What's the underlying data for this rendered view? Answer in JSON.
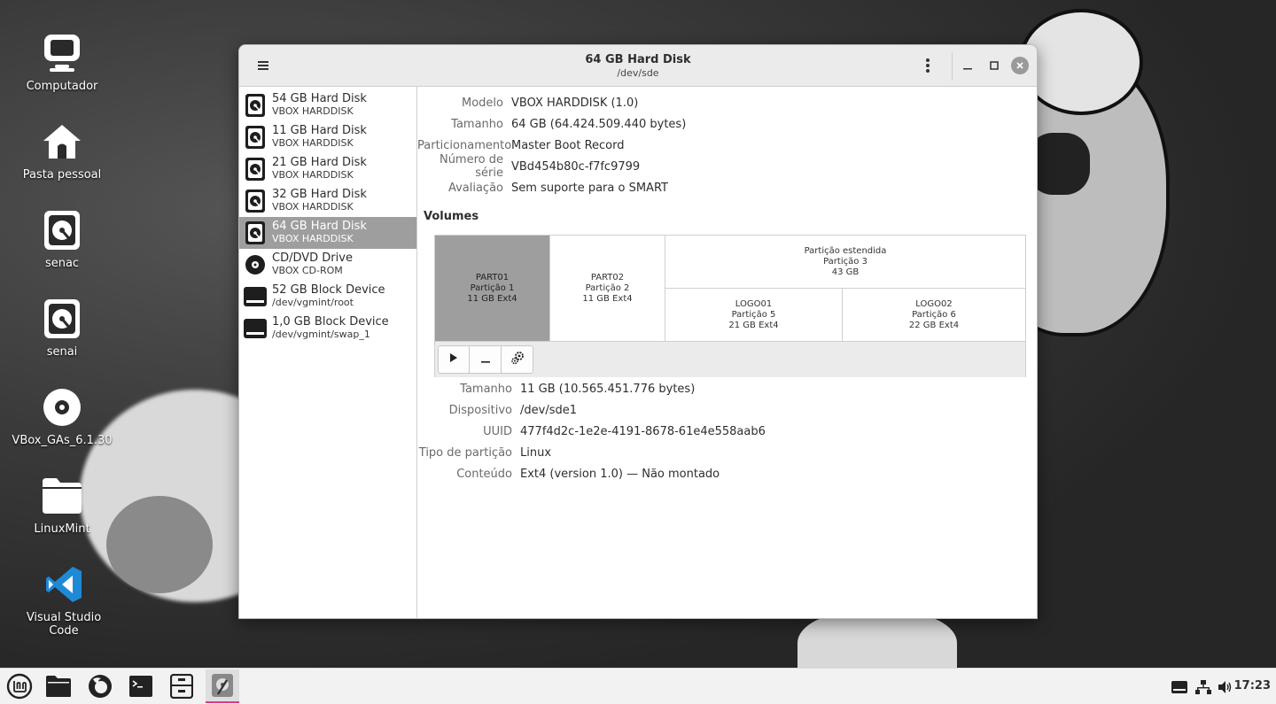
{
  "desktop": {
    "icons": [
      {
        "label": "Computador",
        "icon": "monitor-icon"
      },
      {
        "label": "Pasta pessoal",
        "icon": "home-icon"
      },
      {
        "label": "senac",
        "icon": "harddisk-icon"
      },
      {
        "label": "senai",
        "icon": "harddisk-icon"
      },
      {
        "label": "VBox_GAs_6.1.30",
        "icon": "disc-icon"
      },
      {
        "label": "LinuxMint",
        "icon": "folder-icon"
      },
      {
        "label": "Visual Studio Code",
        "icon": "vscode-icon"
      }
    ]
  },
  "window": {
    "title": "64 GB Hard Disk",
    "subtitle": "/dev/sde",
    "buttons": {
      "menu": "hamburger-menu-icon",
      "more": "vertical-dots-icon",
      "minimize": "minimize-icon",
      "maximize": "maximize-icon",
      "close": "close-icon"
    }
  },
  "sidebar": {
    "items": [
      {
        "name": "54 GB Hard Disk",
        "sub": "VBOX HARDDISK",
        "icon": "harddisk-icon",
        "selected": false
      },
      {
        "name": "11 GB Hard Disk",
        "sub": "VBOX HARDDISK",
        "icon": "harddisk-icon",
        "selected": false
      },
      {
        "name": "21 GB Hard Disk",
        "sub": "VBOX HARDDISK",
        "icon": "harddisk-icon",
        "selected": false
      },
      {
        "name": "32 GB Hard Disk",
        "sub": "VBOX HARDDISK",
        "icon": "harddisk-icon",
        "selected": false
      },
      {
        "name": "64 GB Hard Disk",
        "sub": "VBOX HARDDISK",
        "icon": "harddisk-icon",
        "selected": true
      },
      {
        "name": "CD/DVD Drive",
        "sub": "VBOX CD-ROM",
        "icon": "optical-drive-icon",
        "selected": false
      },
      {
        "name": "52 GB Block Device",
        "sub": "/dev/vgmint/root",
        "icon": "block-device-icon",
        "selected": false
      },
      {
        "name": "1,0 GB Block Device",
        "sub": "/dev/vgmint/swap_1",
        "icon": "block-device-icon",
        "selected": false
      }
    ]
  },
  "disk_info": {
    "model_label": "Modelo",
    "model": "VBOX HARDDISK (1.0)",
    "size_label": "Tamanho",
    "size": "64 GB (64.424.509.440 bytes)",
    "partitioning_label": "Particionamento",
    "partitioning": "Master Boot Record",
    "serial_label": "Número de série",
    "serial": "VBd454b80c-f7fc9799",
    "assessment_label": "Avaliação",
    "assessment": "Sem suporte para o SMART"
  },
  "volumes": {
    "heading": "Volumes",
    "partitions": {
      "part1": {
        "name": "PART01",
        "type": "Partição 1",
        "size": "11 GB Ext4"
      },
      "part2": {
        "name": "PART02",
        "type": "Partição 2",
        "size": "11 GB Ext4"
      },
      "extended": {
        "name": "Partição estendida",
        "type": "Partição 3",
        "size": "43 GB"
      },
      "logo1": {
        "name": "LOGO01",
        "type": "Partição 5",
        "size": "21 GB Ext4"
      },
      "logo2": {
        "name": "LOGO02",
        "type": "Partição 6",
        "size": "22 GB Ext4"
      }
    },
    "toolbar": {
      "mount": "play-icon",
      "delete": "minus-icon",
      "settings": "gears-icon"
    }
  },
  "volume_info": {
    "size_label": "Tamanho",
    "size": "11 GB (10.565.451.776 bytes)",
    "device_label": "Dispositivo",
    "device": "/dev/sde1",
    "uuid_label": "UUID",
    "uuid": "477f4d2c-1e2e-4191-8678-61e4e558aab6",
    "ptype_label": "Tipo de partição",
    "ptype": "Linux",
    "content_label": "Conteúdo",
    "content": "Ext4 (version 1.0) — Não montado"
  },
  "taskbar": {
    "apps": [
      "mint-menu-icon",
      "files-icon",
      "firefox-icon",
      "terminal-icon",
      "archive-icon",
      "disks-icon"
    ],
    "tray": [
      "display-icon",
      "network-icon",
      "volume-icon"
    ],
    "clock": "17:23",
    "accent": "#d63f7f"
  }
}
